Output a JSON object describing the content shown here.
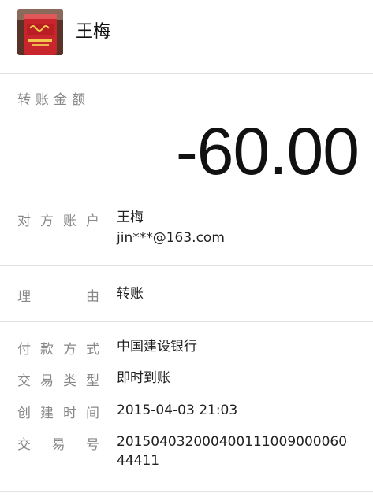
{
  "header": {
    "avatar_icon": "product-photo-avatar",
    "contact_name": "王梅"
  },
  "amount": {
    "label": "转账金额",
    "value": "-60.00"
  },
  "payee": {
    "label": "对方账户",
    "name": "王梅",
    "account": "jin***@163.com"
  },
  "reason": {
    "label": "理由",
    "value": "转账"
  },
  "details": [
    {
      "label": "付款方式",
      "value": "中国建设银行"
    },
    {
      "label": "交易类型",
      "value": "即时到账"
    },
    {
      "label": "创建时间",
      "value": "2015-04-03 21:03"
    },
    {
      "label": "交易号",
      "value": "20150403200040011100900006044411"
    }
  ]
}
